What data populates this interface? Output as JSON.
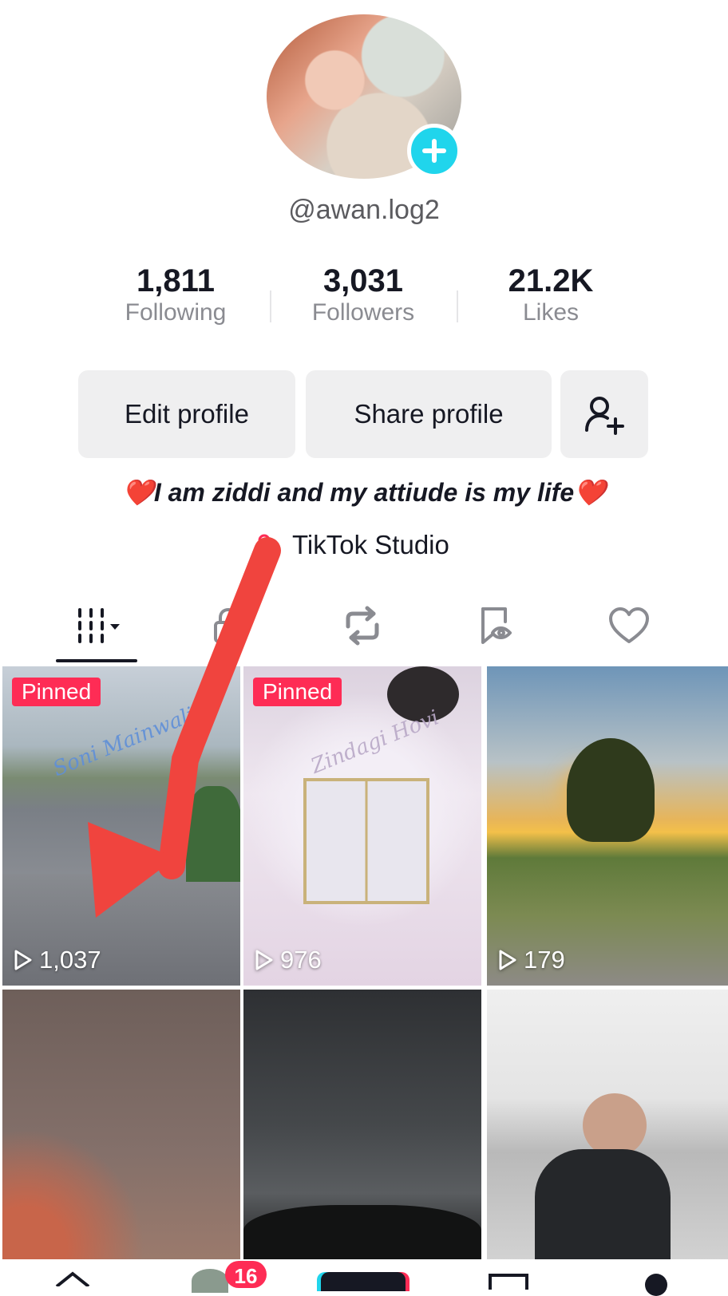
{
  "profile": {
    "username": "@awan.log2",
    "stats": [
      {
        "value": "1,811",
        "label": "Following"
      },
      {
        "value": "3,031",
        "label": "Followers"
      },
      {
        "value": "21.2K",
        "label": "Likes"
      }
    ],
    "buttons": {
      "edit": "Edit profile",
      "share": "Share profile"
    },
    "bio": "❤️I  am ziddi and my attiude is my life❤️",
    "studio_link": "TikTok Studio"
  },
  "tabs": [
    "videos-grid-icon",
    "lock-icon",
    "repost-icon",
    "favorites-icon",
    "heart-icon"
  ],
  "videos": [
    {
      "pinned": "Pinned",
      "views": "1,037",
      "watermark": "Soni Mainwali"
    },
    {
      "pinned": "Pinned",
      "views": "976",
      "watermark": "Zindagi Hovi"
    },
    {
      "views": "179"
    },
    {},
    {},
    {}
  ],
  "bottom_nav": {
    "inbox_badge": "16"
  },
  "colors": {
    "accent": "#fe2c55",
    "add_button": "#20d5ec",
    "arrow": "#f0443e"
  }
}
